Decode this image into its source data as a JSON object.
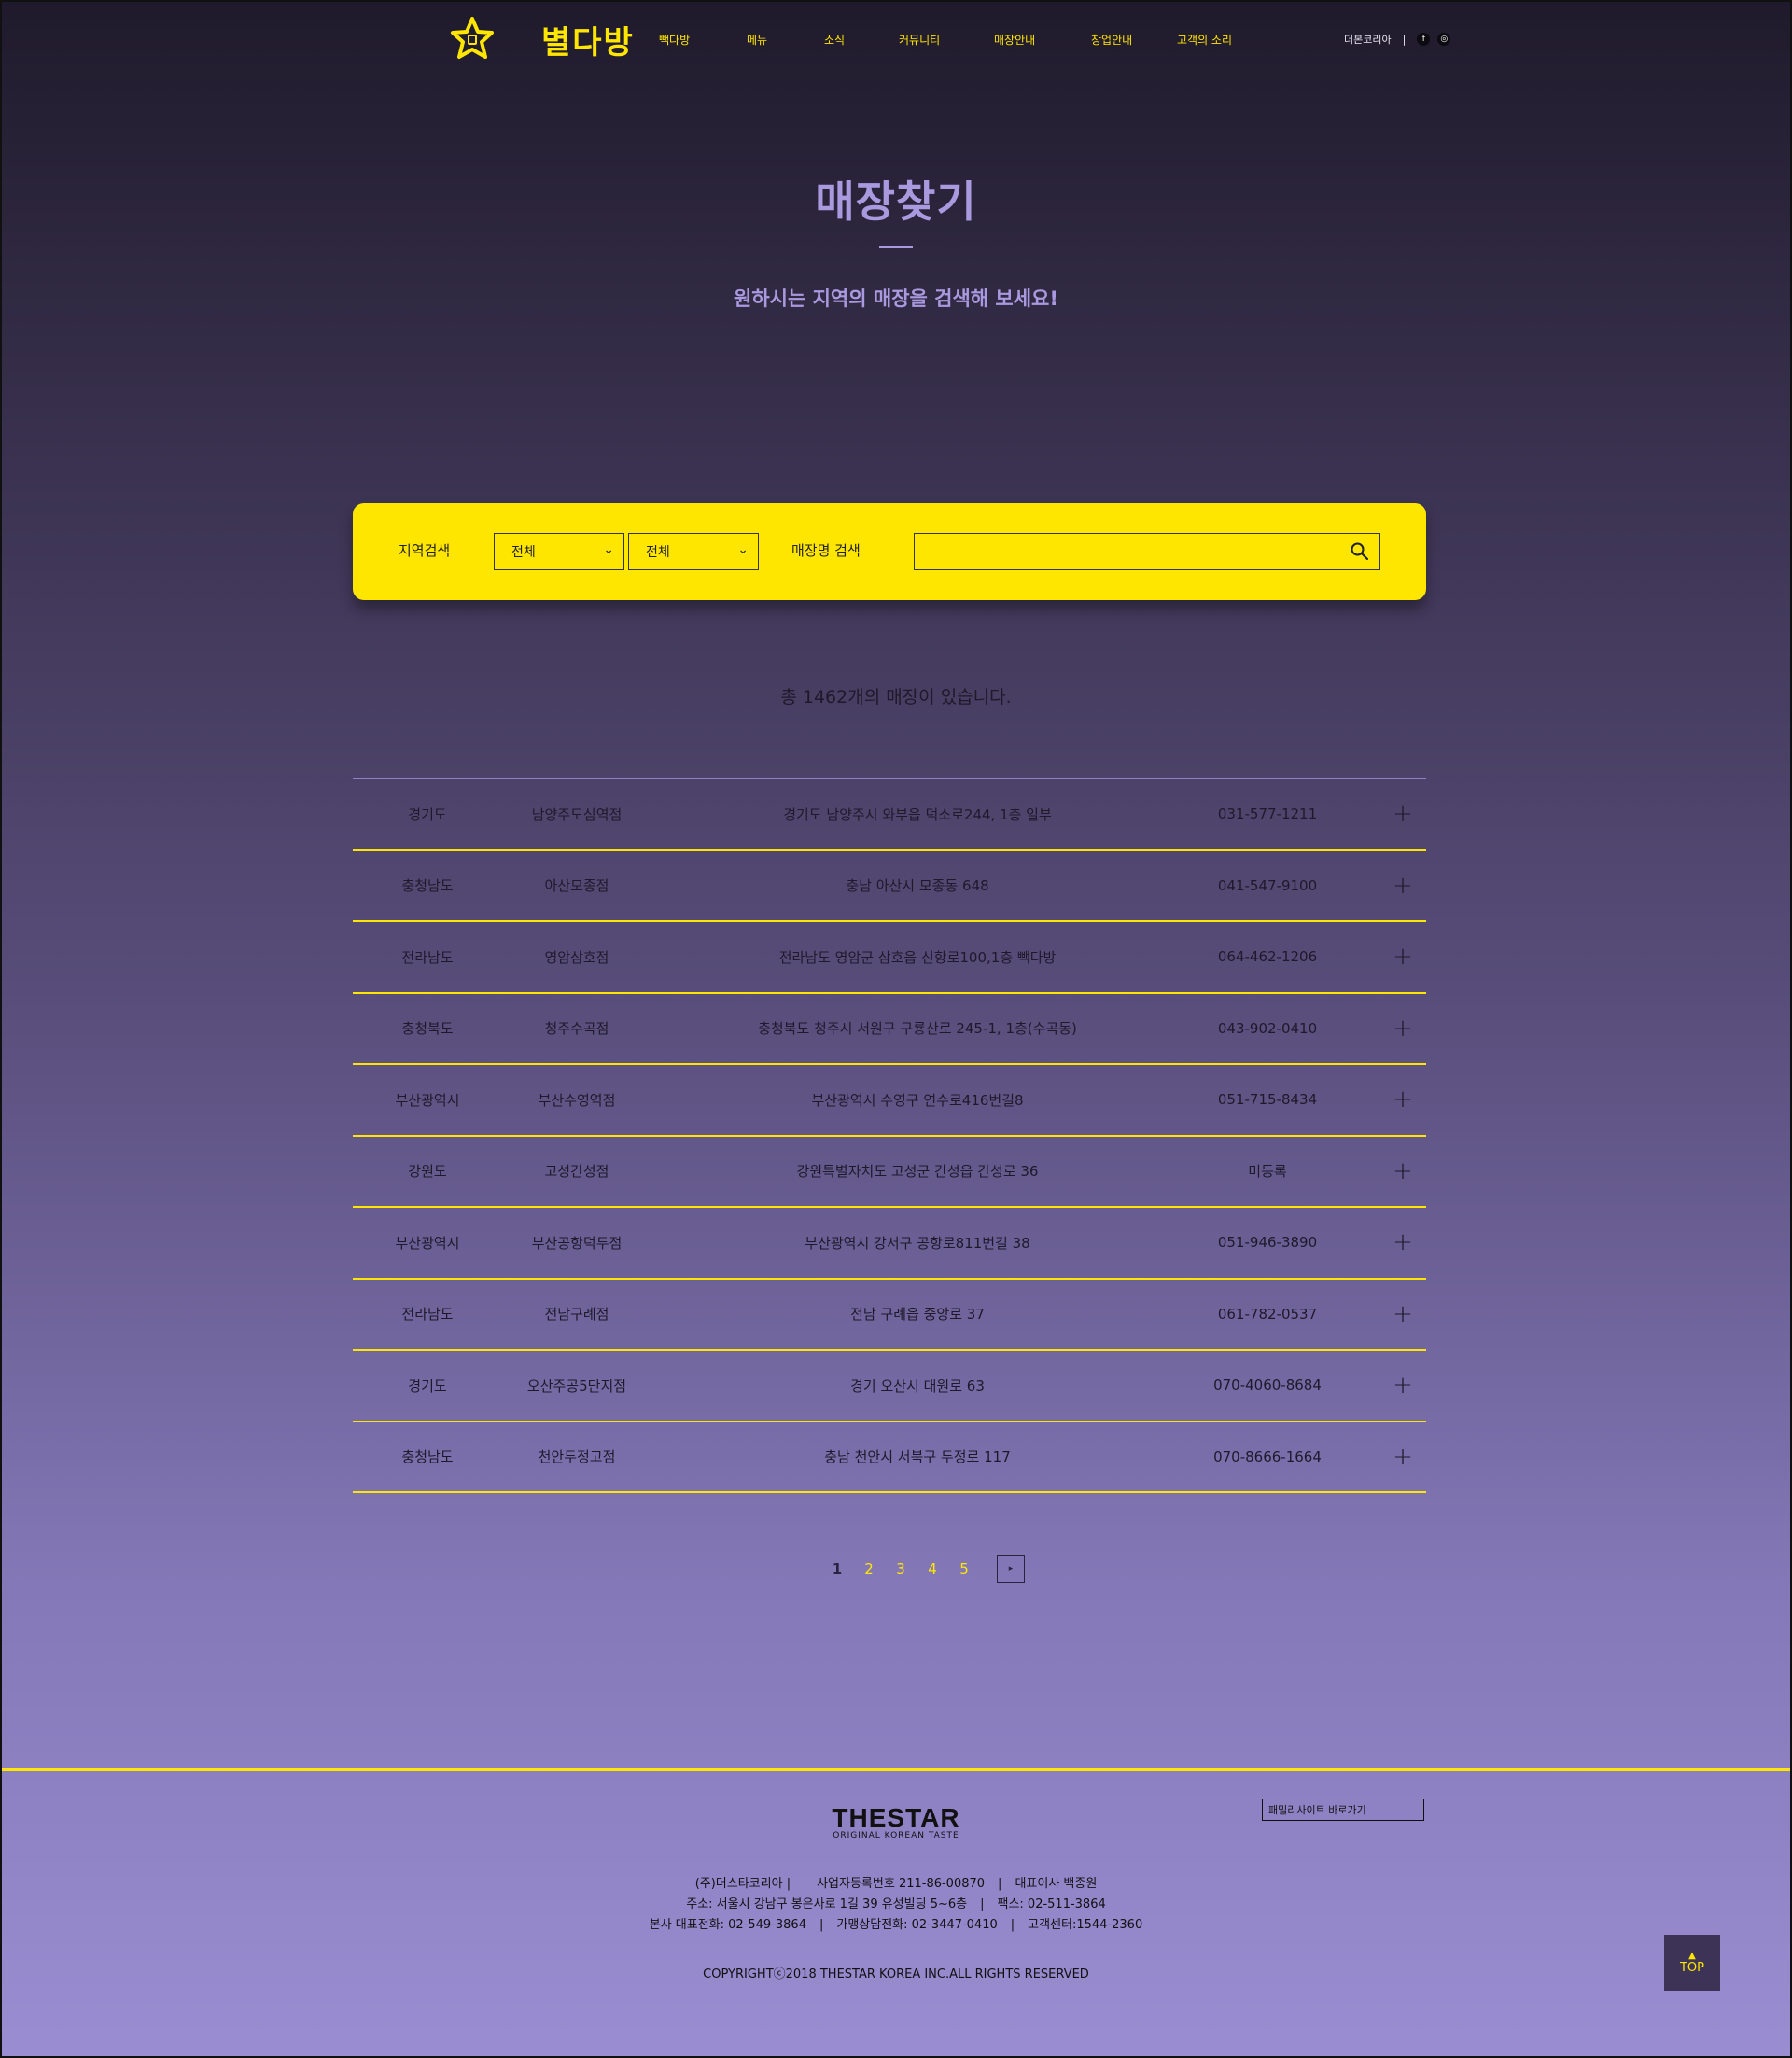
{
  "brand": {
    "logo_text": "별다방",
    "accent": "#ffe600",
    "title_color": "#a99ae0"
  },
  "nav": [
    "빽다방",
    "메뉴",
    "소식",
    "커뮤니티",
    "매장안내",
    "창업안내",
    "고객의 소리"
  ],
  "util": {
    "company": "더본코리아",
    "sep": "|",
    "sns": [
      "facebook-icon",
      "instagram-icon"
    ]
  },
  "hero": {
    "title": "매장찾기",
    "subtitle": "원하시는 지역의 매장을 검색해 보세요!"
  },
  "search": {
    "region_label": "지역검색",
    "select1": "전체",
    "select2": "전체",
    "name_label": "매장명 검색",
    "placeholder": ""
  },
  "total_text": "총 1462개의 매장이 있습니다.",
  "stores": [
    {
      "region": "경기도",
      "name": "남양주도심역점",
      "address": "경기도 남양주시 와부읍 덕소로244, 1층 일부",
      "phone": "031-577-1211"
    },
    {
      "region": "충청남도",
      "name": "아산모종점",
      "address": "충남 아산시 모종동 648",
      "phone": "041-547-9100"
    },
    {
      "region": "전라남도",
      "name": "영암삼호점",
      "address": "전라남도 영암군 삼호읍 신항로100,1층 빽다방",
      "phone": "064-462-1206"
    },
    {
      "region": "충청북도",
      "name": "청주수곡점",
      "address": "충청북도 청주시 서원구 구룡산로 245-1, 1층(수곡동)",
      "phone": "043-902-0410"
    },
    {
      "region": "부산광역시",
      "name": "부산수영역점",
      "address": "부산광역시 수영구 연수로416번길8",
      "phone": "051-715-8434"
    },
    {
      "region": "강원도",
      "name": "고성간성점",
      "address": "강원특별자치도 고성군 간성읍 간성로 36",
      "phone": "미등록"
    },
    {
      "region": "부산광역시",
      "name": "부산공항덕두점",
      "address": "부산광역시 강서구 공항로811번길 38",
      "phone": "051-946-3890"
    },
    {
      "region": "전라남도",
      "name": "전남구례점",
      "address": "전남 구례읍 중앙로 37",
      "phone": "061-782-0537"
    },
    {
      "region": "경기도",
      "name": "오산주공5단지점",
      "address": "경기 오산시 대원로 63",
      "phone": "070-4060-8684"
    },
    {
      "region": "충청남도",
      "name": "천안두정고점",
      "address": "충남 천안시 서북구 두정로 117",
      "phone": "070-8666-1664"
    }
  ],
  "pagination": {
    "pages": [
      "1",
      "2",
      "3",
      "4",
      "5"
    ],
    "current": "1",
    "next": "▸"
  },
  "footer": {
    "logo": "THESTAR",
    "tagline": "ORIGINAL KOREAN TASTE",
    "family_site": "패밀리사이트 바로가기",
    "line1": [
      "(주)더스타코리아 |",
      "사업자등록번호 211-86-00870",
      "|",
      "대표이사 백종원"
    ],
    "line2": [
      "주소: 서울시 강남구 봉은사로 1길 39 유성빌딩 5~6층",
      "|",
      "팩스: 02-511-3864"
    ],
    "line3": [
      "본사 대표전화: 02-549-3864",
      "|",
      "가맹상담전화: 02-3447-0410",
      "|",
      "고객센터:1544-2360"
    ],
    "copyright": "COPYRIGHTⓒ2018 THESTAR KOREA INC.ALL RIGHTS RESERVED",
    "top_label": "TOP",
    "top_arrow": "▲"
  }
}
